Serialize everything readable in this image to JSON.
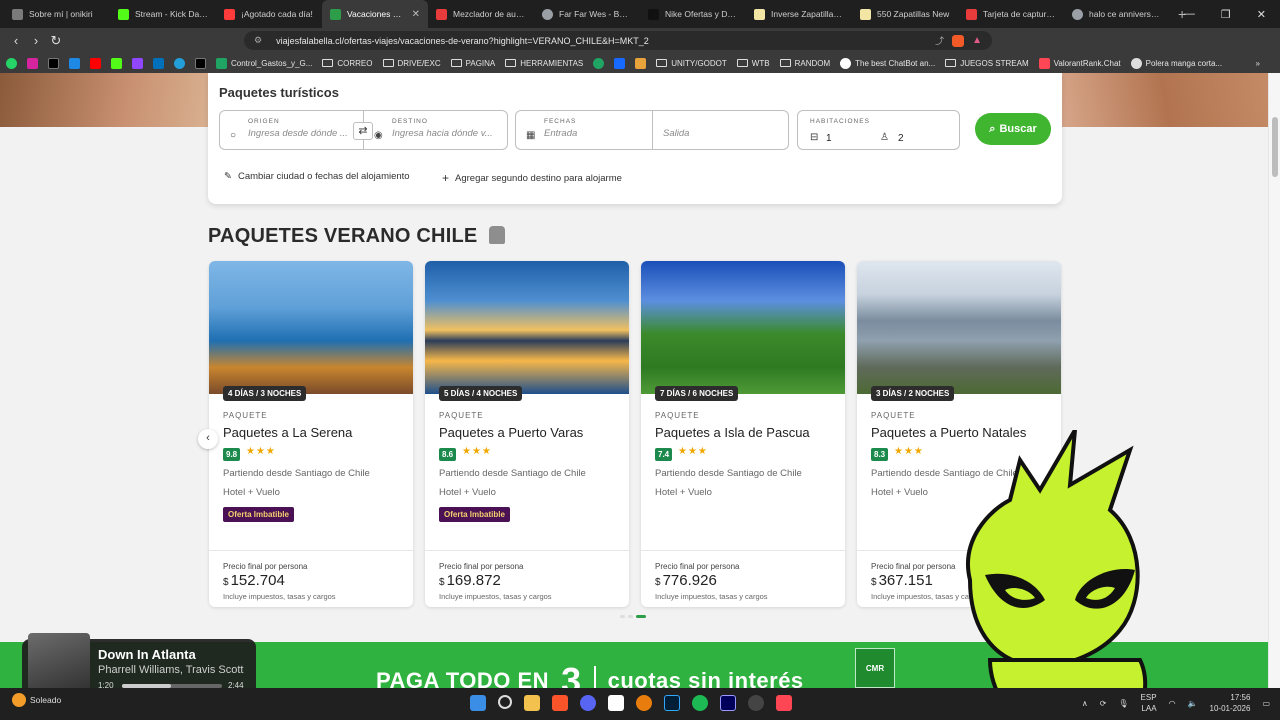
{
  "browser": {
    "tabs": [
      {
        "title": "Sobre mí | onikiri",
        "color": "#7a7a7a",
        "active": false
      },
      {
        "title": "Stream - Kick Dashboard",
        "color": "#53fc18",
        "active": false
      },
      {
        "title": "¡Agotado cada día!",
        "color": "#ff3b3b",
        "active": false
      },
      {
        "title": "Vacaciones de Verano",
        "color": "#2e9d4a",
        "active": true
      },
      {
        "title": "Mezclador de audio",
        "color": "#e83c3c",
        "active": false
      },
      {
        "title": "Far Far Wes - Buscar",
        "color": "#9aa0a6",
        "active": false
      },
      {
        "title": "Nike Ofertas y Descuentos",
        "color": "#111111",
        "active": false
      },
      {
        "title": "Inverse Zapatillas Pack",
        "color": "#f3e6a5",
        "active": false
      },
      {
        "title": "550 Zapatillas New",
        "color": "#f3e6a5",
        "active": false
      },
      {
        "title": "Tarjeta de captura H",
        "color": "#e83c3c",
        "active": false
      },
      {
        "title": "halo ce anniversary",
        "color": "#9aa0a6",
        "active": false
      }
    ],
    "url": "viajesfalabella.cl/ofertas-viajes/vacaciones-de-verano?highlight=VERANO_CHILE&H=MKT_2",
    "bookmarks": [
      "Control_Gastos_y_G...",
      "CORREO",
      "DRIVE/EXC",
      "PAGINA",
      "HERRAMIENTAS",
      "UNITY/GODOT",
      "WTB",
      "RANDOM",
      "The best ChatBot an...",
      "JUEGOS STREAM",
      "ValorantRank.Chat",
      "Polera manga corta..."
    ]
  },
  "search": {
    "title": "Paquetes turísticos",
    "origin_label": "ORIGEN",
    "origin_placeholder": "Ingresa desde dónde ...",
    "dest_label": "DESTINO",
    "dest_placeholder": "Ingresa hacia dónde v...",
    "dates_label": "FECHAS",
    "entry_placeholder": "Entrada",
    "exit_placeholder": "Salida",
    "rooms_label": "HABITACIONES",
    "rooms_value": "1",
    "guests_value": "2",
    "button": "Buscar",
    "link_change": "Cambiar ciudad o fechas del alojamiento",
    "link_add": "Agregar segundo destino para alojarme"
  },
  "section": {
    "title": "PAQUETES VERANO CHILE"
  },
  "cards": [
    {
      "duration": "4 DÍAS / 3 NOCHES",
      "type": "PAQUETE",
      "name": "Paquetes a La Serena",
      "score": "9.8",
      "stars": "★★★",
      "origin": "Partiendo desde Santiago de Chile",
      "includes": "Hotel + Vuelo",
      "badge": "Oferta Imbatible",
      "price_label": "Precio final por persona",
      "currency": "$",
      "price": "152.704",
      "price_note": "Incluye impuestos, tasas y cargos"
    },
    {
      "duration": "5 DÍAS / 4 NOCHES",
      "type": "PAQUETE",
      "name": "Paquetes a Puerto Varas",
      "score": "8.6",
      "stars": "★★★",
      "origin": "Partiendo desde Santiago de Chile",
      "includes": "Hotel + Vuelo",
      "badge": "Oferta Imbatible",
      "price_label": "Precio final por persona",
      "currency": "$",
      "price": "169.872",
      "price_note": "Incluye impuestos, tasas y cargos"
    },
    {
      "duration": "7 DÍAS / 6 NOCHES",
      "type": "PAQUETE",
      "name": "Paquetes a Isla de Pascua",
      "score": "7.4",
      "stars": "★★★",
      "origin": "Partiendo desde Santiago de Chile",
      "includes": "Hotel + Vuelo",
      "badge": "",
      "price_label": "Precio final por persona",
      "currency": "$",
      "price": "776.926",
      "price_note": "Incluye impuestos, tasas y cargos"
    },
    {
      "duration": "3 DÍAS / 2 NOCHES",
      "type": "PAQUETE",
      "name": "Paquetes a Puerto Natales",
      "score": "8.3",
      "stars": "★★★",
      "origin": "Partiendo desde Santiago de Chile",
      "includes": "Hotel + Vuelo",
      "badge": "",
      "price_label": "Precio final por persona",
      "currency": "$",
      "price": "367.151",
      "price_note": "Incluye impuestos, tasas y cargos"
    }
  ],
  "banner": {
    "pre": "PAGA TODO EN",
    "num": "3",
    "post": "cuotas sin interés",
    "logo": "CMR"
  },
  "media": {
    "title": "Down In Atlanta",
    "artist": "Pharrell Williams, Travis Scott",
    "elapsed": "1:20",
    "total": "2:44",
    "progress": 0.49
  },
  "taskbar": {
    "weather": "Soleado",
    "lang_top": "ESP",
    "lang_bottom": "LAA",
    "time": "17:56",
    "date": "10-01-2026"
  }
}
